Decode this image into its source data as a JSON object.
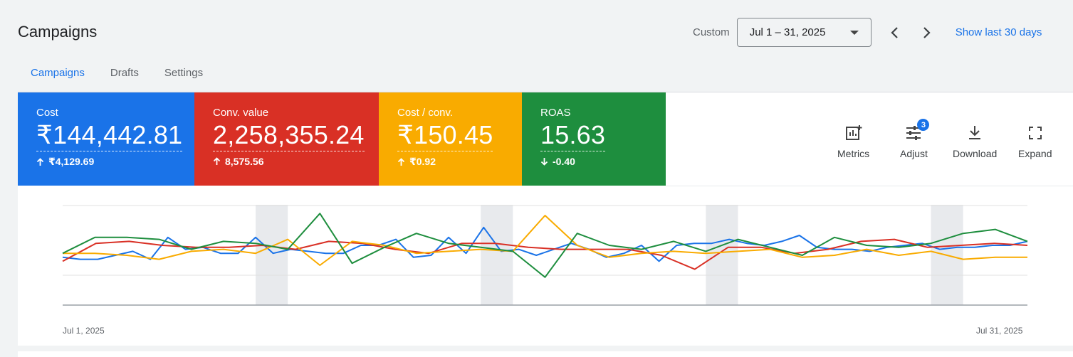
{
  "page": {
    "title": "Campaigns"
  },
  "date_range": {
    "mode_label": "Custom",
    "selected": "Jul 1 – 31, 2025",
    "show_last_label": "Show last 30 days"
  },
  "tabs": [
    {
      "label": "Campaigns",
      "active": true
    },
    {
      "label": "Drafts",
      "active": false
    },
    {
      "label": "Settings",
      "active": false
    }
  ],
  "metrics": [
    {
      "label": "Cost",
      "value": "₹144,442.81",
      "change": "₹4,129.69",
      "direction": "up",
      "color": "#1a73e8"
    },
    {
      "label": "Conv. value",
      "value": "2,258,355.24",
      "change": "8,575.56",
      "direction": "up",
      "color": "#d93025"
    },
    {
      "label": "Cost / conv.",
      "value": "₹150.45",
      "change": "₹0.92",
      "direction": "up",
      "color": "#f9ab00"
    },
    {
      "label": "ROAS",
      "value": "15.63",
      "change": "-0.40",
      "direction": "down",
      "color": "#1e8e3e"
    }
  ],
  "tools": {
    "metrics_label": "Metrics",
    "adjust_label": "Adjust",
    "adjust_badge": "3",
    "download_label": "Download",
    "expand_label": "Expand"
  },
  "chart_data": {
    "type": "line",
    "x_start_label": "Jul 1, 2025",
    "x_end_label": "Jul 31, 2025",
    "grid": true,
    "weekend_bands": [
      [
        7,
        8
      ],
      [
        14,
        15
      ],
      [
        21,
        22
      ],
      [
        28,
        29
      ]
    ],
    "series": [
      {
        "color": "#1a73e8",
        "values": [
          48,
          46,
          46,
          50,
          54,
          46,
          68,
          56,
          58,
          52,
          52,
          68,
          52,
          56,
          54,
          52,
          52,
          60,
          60,
          66,
          48,
          50,
          68,
          52,
          78,
          54,
          56,
          50,
          56,
          62,
          56,
          48,
          52,
          60,
          44,
          60,
          62,
          62,
          66,
          62,
          60,
          64,
          70,
          58,
          56,
          56,
          54,
          58,
          60,
          62,
          56,
          58,
          58,
          60,
          60,
          64
        ]
      },
      {
        "color": "#d93025",
        "values": [
          44,
          62,
          64,
          60,
          58,
          58,
          60,
          56,
          64,
          62,
          56,
          52,
          62,
          62,
          58,
          56,
          56,
          56,
          50,
          36,
          58,
          58,
          52,
          56,
          64,
          66,
          58,
          60,
          62,
          60
        ]
      },
      {
        "color": "#f9ab00",
        "values": [
          52,
          52,
          50,
          46,
          54,
          56,
          52,
          66,
          40,
          64,
          60,
          52,
          54,
          56,
          54,
          90,
          60,
          48,
          52,
          54,
          52,
          54,
          56,
          48,
          50,
          56,
          50,
          54,
          46,
          48,
          48
        ]
      },
      {
        "color": "#1e8e3e",
        "values": [
          52,
          68,
          68,
          66,
          56,
          64,
          62,
          56,
          92,
          42,
          58,
          72,
          62,
          58,
          54,
          28,
          72,
          60,
          56,
          64,
          54,
          66,
          58,
          50,
          68,
          60,
          58,
          62,
          72,
          76,
          64
        ]
      }
    ],
    "ylim": [
      0,
      100
    ]
  }
}
